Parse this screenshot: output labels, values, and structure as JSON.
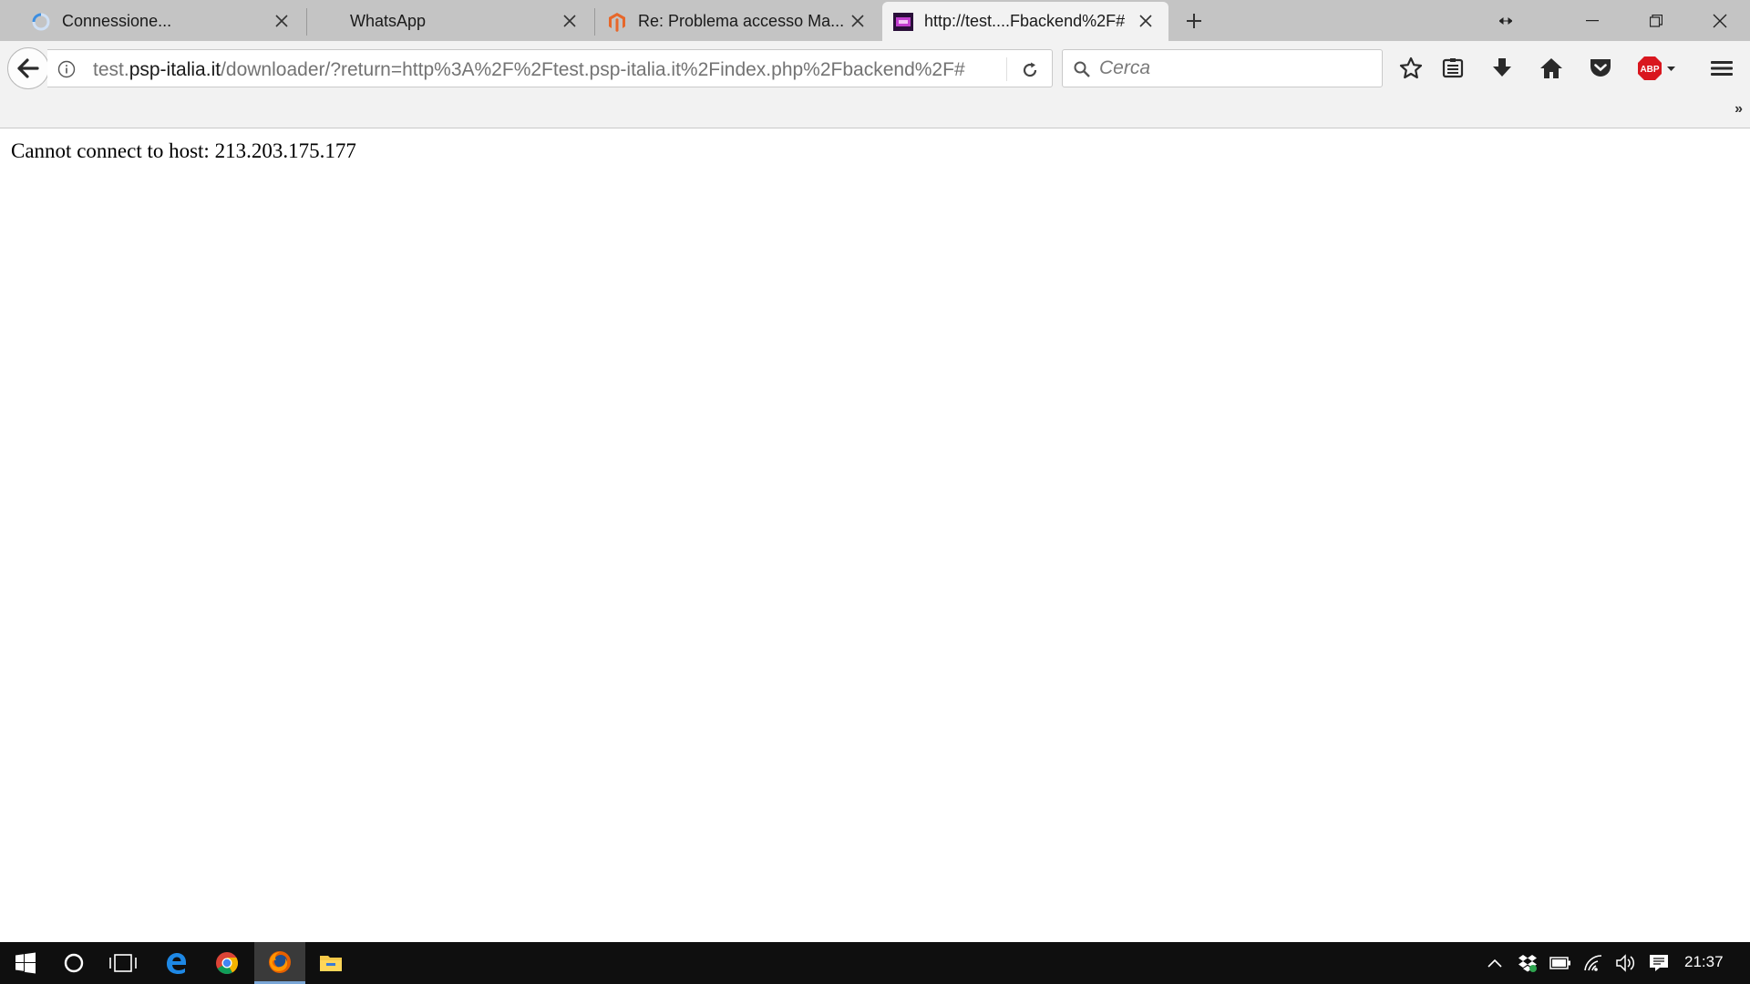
{
  "tabs": [
    {
      "label": "Connessione...",
      "icon": "loading-spinner-icon"
    },
    {
      "label": "WhatsApp",
      "icon": ""
    },
    {
      "label": "Re: Problema accesso Ma...",
      "icon": "magento-icon"
    },
    {
      "label": "http://test....Fbackend%2F#",
      "icon": "site-favicon-icon",
      "active": true
    }
  ],
  "address": {
    "prefix": "test.",
    "host": "psp-italia.it",
    "path": "/downloader/?return=http%3A%2F%2Ftest.psp-italia.it%2Findex.php%2Fbackend%2F#"
  },
  "search": {
    "placeholder": "Cerca"
  },
  "page": {
    "message": "Cannot connect to host: 213.203.175.177"
  },
  "taskbar": {
    "clock": "21:37"
  },
  "colors": {
    "accent": "#7aa6d6",
    "taskbar": "#0f0f0f",
    "abp": "#d9171f"
  }
}
